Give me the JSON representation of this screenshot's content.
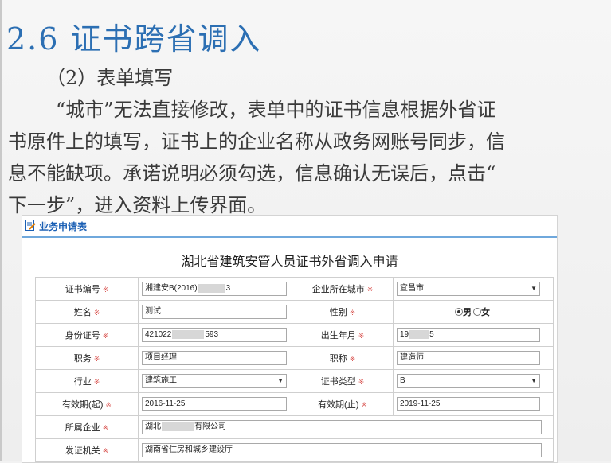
{
  "slide": {
    "title": "2.6 证书跨省调入",
    "subheading": "（2）表单填写",
    "paragraph": "“城市”无法直接修改，表单中的证书信息根据外省证书原件上的填写，证书上的企业名称从政务网账号同步，信息不能缺项。承诺说明必须勾选，信息确认无误后，点击“下一步”，进入资料上传界面。",
    "paragraph_lines": [
      "“城市”无法直接修改，表单中的证书信息根据外省证",
      "书原件上的填写，证书上的企业名称从政务网账号同步，信",
      "息不能缺项。承诺说明必须勾选，信息确认无误后，点击“",
      "下一步”，进入资料上传界面。"
    ]
  },
  "app": {
    "header_title": "业务申请表",
    "header_icon": "form-edit-icon",
    "form_title": "湖北省建筑安管人员证书外省调入申请",
    "required_mark": "※",
    "accent_color": "#1a5fb4",
    "required_color": "#d9534f",
    "fields": {
      "cert_no": {
        "label": "证书编号",
        "value_prefix": "湘建安B(2016)",
        "value_suffix": "3"
      },
      "city": {
        "label": "企业所在城市",
        "value": "宜昌市"
      },
      "name": {
        "label": "姓名",
        "value": "测试"
      },
      "gender": {
        "label": "性别",
        "option_male": "男",
        "option_female": "女",
        "selected": "男"
      },
      "id_no": {
        "label": "身份证号",
        "value_prefix": "421022",
        "value_suffix": "593"
      },
      "birth": {
        "label": "出生年月",
        "value_prefix": "19",
        "value_suffix": "5"
      },
      "duty": {
        "label": "职务",
        "value": "项目经理"
      },
      "title": {
        "label": "职称",
        "value": "建造师"
      },
      "industry": {
        "label": "行业",
        "value": "建筑施工"
      },
      "cert_type": {
        "label": "证书类型",
        "value": "B"
      },
      "valid_from": {
        "label": "有效期(起)",
        "value": "2016-11-25"
      },
      "valid_to": {
        "label": "有效期(止)",
        "value": "2019-11-25"
      },
      "company": {
        "label": "所属企业",
        "value_prefix": "湖北",
        "value_suffix": "有限公司"
      },
      "issuer": {
        "label": "发证机关",
        "value": "湖南省住房和城乡建设厅"
      }
    }
  }
}
